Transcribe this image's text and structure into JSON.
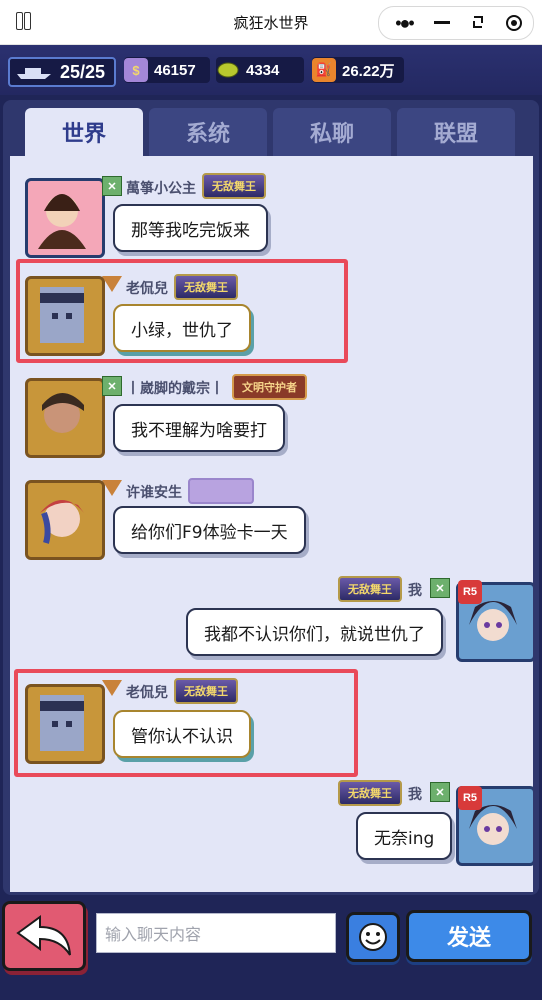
{
  "window": {
    "title": "疯狂水世界"
  },
  "resources": {
    "ships": "25/25",
    "coins": "46157",
    "seeds": "4334",
    "fuel": "26.22万"
  },
  "tabs": [
    "世界",
    "系统",
    "私聊",
    "联盟"
  ],
  "messages": [
    {
      "name": "萬箏小公主",
      "badge": "无敌舞王",
      "text": "那等我吃完饭来"
    },
    {
      "name": "老侃兒",
      "badge": "无敌舞王",
      "text": "小绿，世仇了"
    },
    {
      "name": "丨崴脚的戴宗丨",
      "badge": "文明守护者",
      "text": "我不理解为啥要打"
    },
    {
      "name": "许谁安生",
      "badge": "",
      "text": "给你们F9体验卡一天"
    },
    {
      "name": "我",
      "badge": "无敌舞王",
      "rank": "R5",
      "text": "我都不认识你们，就说世仇了"
    },
    {
      "name": "老侃兒",
      "badge": "无敌舞王",
      "text": "管你认不认识"
    },
    {
      "name": "我",
      "badge": "无敌舞王",
      "rank": "R5",
      "text": "无奈ing"
    }
  ],
  "input": {
    "placeholder": "输入聊天内容"
  },
  "send_label": "发送",
  "colors": {
    "highlight": "#e94a5a",
    "active_tab": "#2f3c8c",
    "send": "#3d8ae8"
  }
}
